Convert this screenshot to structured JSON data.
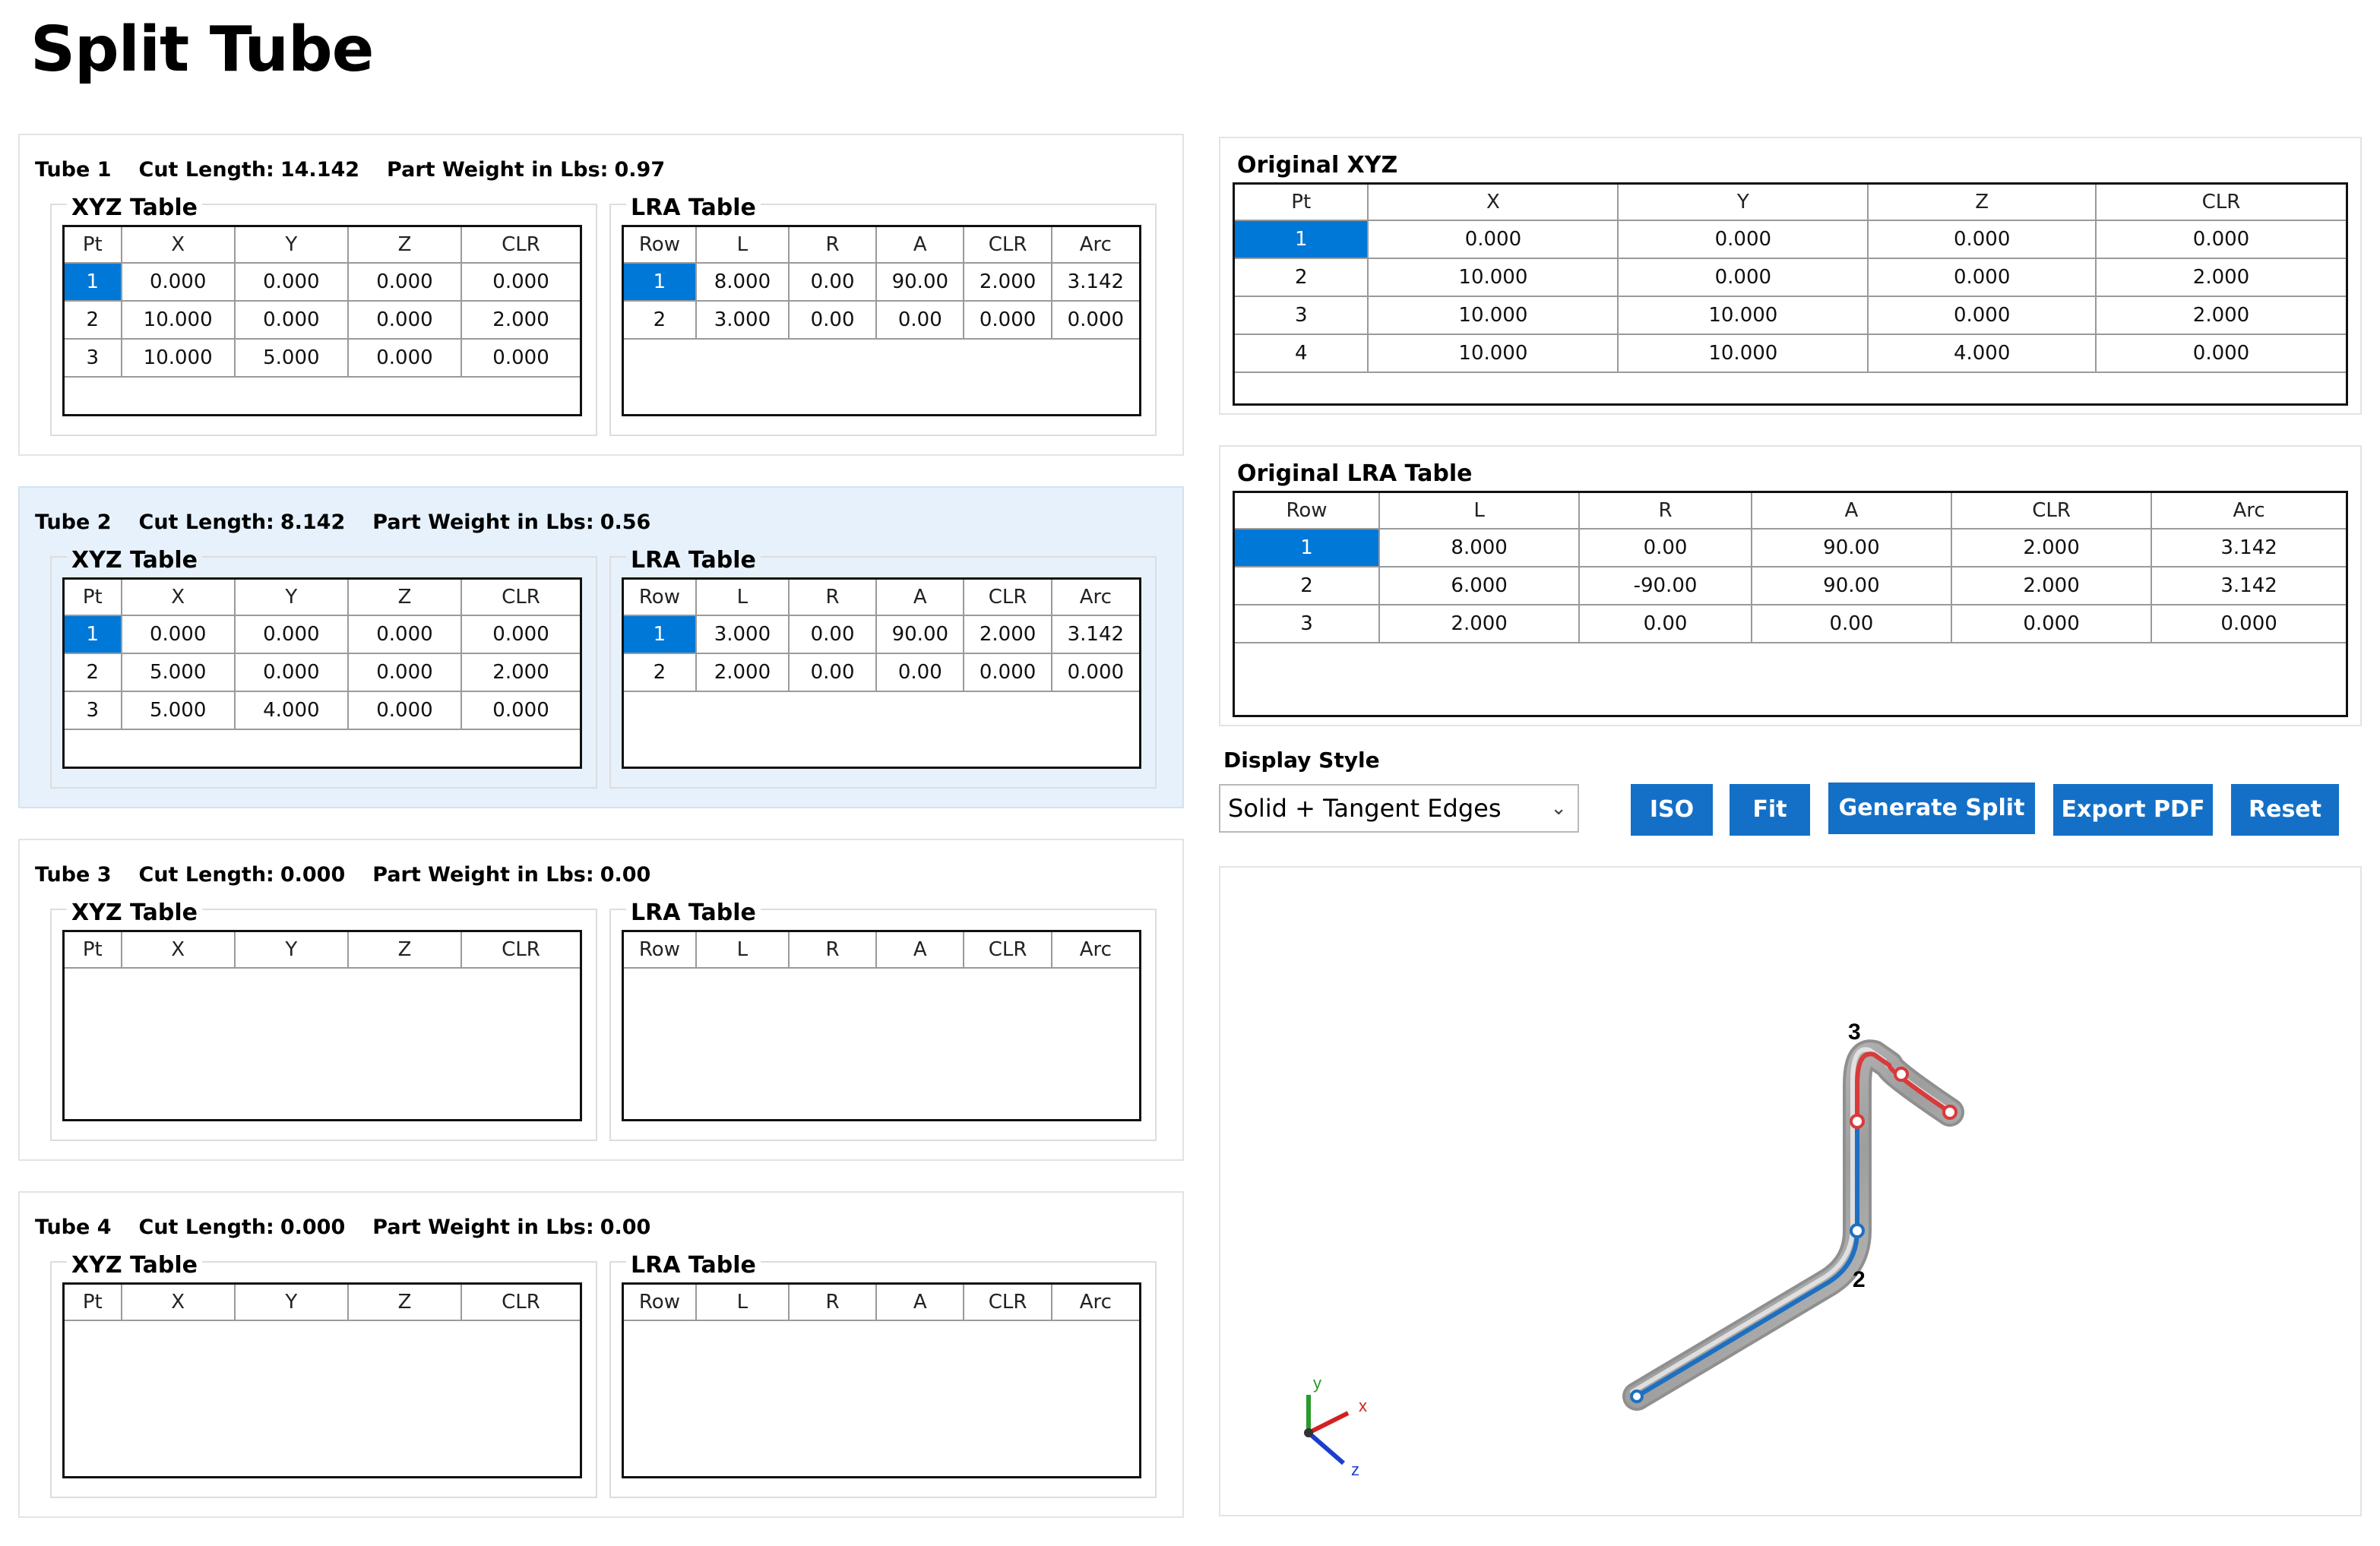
{
  "page": {
    "title": "Split Tube"
  },
  "labels": {
    "xyz_table": "XYZ Table",
    "lra_table": "LRA Table",
    "cut_length": "Cut Length:",
    "part_weight": "Part Weight in Lbs:"
  },
  "xyz_headers": [
    "Pt",
    "X",
    "Y",
    "Z",
    "CLR"
  ],
  "lra_headers": [
    "Row",
    "L",
    "R",
    "A",
    "CLR",
    "Arc"
  ],
  "tubes": [
    {
      "name": "Tube 1",
      "cut_length": "14.142",
      "part_weight": "0.97",
      "xyz": [
        [
          "1",
          "0.000",
          "0.000",
          "0.000",
          "0.000"
        ],
        [
          "2",
          "10.000",
          "0.000",
          "0.000",
          "2.000"
        ],
        [
          "3",
          "10.000",
          "5.000",
          "0.000",
          "0.000"
        ]
      ],
      "lra": [
        [
          "1",
          "8.000",
          "0.00",
          "90.00",
          "2.000",
          "3.142"
        ],
        [
          "2",
          "3.000",
          "0.00",
          "0.00",
          "0.000",
          "0.000"
        ]
      ]
    },
    {
      "name": "Tube 2",
      "cut_length": "8.142",
      "part_weight": "0.56",
      "xyz": [
        [
          "1",
          "0.000",
          "0.000",
          "0.000",
          "0.000"
        ],
        [
          "2",
          "5.000",
          "0.000",
          "0.000",
          "2.000"
        ],
        [
          "3",
          "5.000",
          "4.000",
          "0.000",
          "0.000"
        ]
      ],
      "lra": [
        [
          "1",
          "3.000",
          "0.00",
          "90.00",
          "2.000",
          "3.142"
        ],
        [
          "2",
          "2.000",
          "0.00",
          "0.00",
          "0.000",
          "0.000"
        ]
      ]
    },
    {
      "name": "Tube 3",
      "cut_length": "0.000",
      "part_weight": "0.00",
      "xyz": [],
      "lra": []
    },
    {
      "name": "Tube 4",
      "cut_length": "0.000",
      "part_weight": "0.00",
      "xyz": [],
      "lra": []
    }
  ],
  "original_xyz": {
    "title": "Original XYZ",
    "headers": [
      "Pt",
      "X",
      "Y",
      "Z",
      "CLR"
    ],
    "rows": [
      [
        "1",
        "0.000",
        "0.000",
        "0.000",
        "0.000"
      ],
      [
        "2",
        "10.000",
        "0.000",
        "0.000",
        "2.000"
      ],
      [
        "3",
        "10.000",
        "10.000",
        "0.000",
        "2.000"
      ],
      [
        "4",
        "10.000",
        "10.000",
        "4.000",
        "0.000"
      ]
    ]
  },
  "original_lra": {
    "title": "Original LRA Table",
    "headers": [
      "Row",
      "L",
      "R",
      "A",
      "CLR",
      "Arc"
    ],
    "rows": [
      [
        "1",
        "8.000",
        "0.00",
        "90.00",
        "2.000",
        "3.142"
      ],
      [
        "2",
        "6.000",
        "-90.00",
        "90.00",
        "2.000",
        "3.142"
      ],
      [
        "3",
        "2.000",
        "0.00",
        "0.00",
        "0.000",
        "0.000"
      ]
    ]
  },
  "display_style": {
    "label": "Display Style",
    "value": "Solid + Tangent Edges"
  },
  "buttons": {
    "iso": "ISO",
    "fit": "Fit",
    "generate": "Generate Split",
    "export": "Export PDF",
    "reset": "Reset"
  },
  "viewport": {
    "point_labels": [
      "2",
      "3"
    ],
    "axes": {
      "x": "x",
      "y": "y",
      "z": "z"
    },
    "colors": {
      "segment_a": "#1e6fc0",
      "segment_b": "#d93a3a",
      "tube": "#a8a8a8",
      "axis_x": "#d42020",
      "axis_y": "#2a9a2a",
      "axis_z": "#1a3fcc"
    }
  }
}
